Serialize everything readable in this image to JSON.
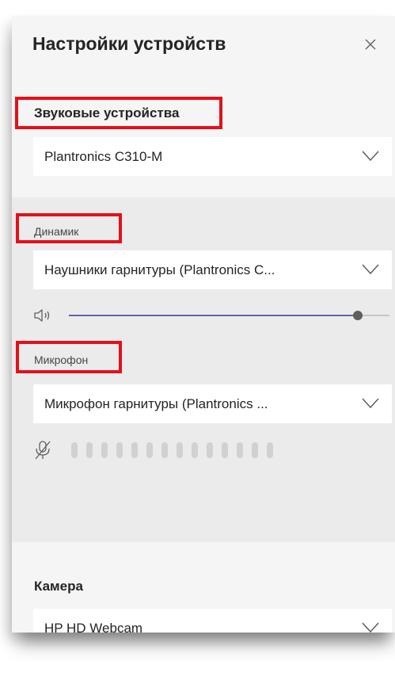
{
  "panel": {
    "title": "Настройки устройств"
  },
  "audio": {
    "section_label": "Звуковые устройства",
    "device_value": "Plantronics C310-M"
  },
  "speaker": {
    "label": "Динамик",
    "device_value": "Наушники гарнитуры (Plantronics C...",
    "volume_fraction": 0.9
  },
  "microphone": {
    "label": "Микрофон",
    "device_value": "Микрофон гарнитуры (Plantronics ...",
    "level_bar_count": 14,
    "muted": true
  },
  "camera": {
    "label": "Камера",
    "device_value": "HP HD Webcam"
  },
  "colors": {
    "highlight": "#e3101a",
    "slider_accent": "#6264a7",
    "panel_bg": "#f5f5f5",
    "band_bg": "#ebebeb"
  },
  "icons": {
    "close": "close-icon",
    "dropdown": "chevron-down-icon",
    "speaker": "speaker-volume-icon",
    "mic": "mic-off-icon"
  }
}
